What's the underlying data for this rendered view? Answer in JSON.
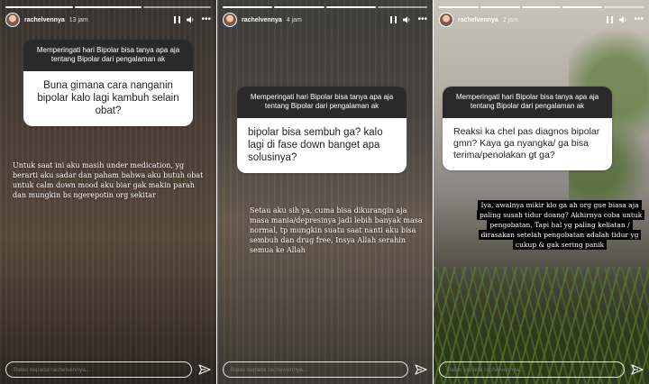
{
  "stories": [
    {
      "username": "rachelvennya",
      "time": "13 jam",
      "question_header": "Memperingati hari Bipolar bisa tanya apa aja tentang Bipolar dari pengalaman ak",
      "question": "Buna gimana cara nanganin bipolar kalo lagi kambuh selain obat?",
      "answer": "Untuk saat ini aku masih under medication, yg berarti aku sadar dan paham bahwa aku butuh obat untuk calm down mood aku biar gak makin parah dan mungkin bs ngerepotin org sekitar",
      "reply_placeholder": "Balas kepada rachelvennya..."
    },
    {
      "username": "rachelvennya",
      "time": "4 jam",
      "question_header": "Memperingati hari Bipolar bisa tanya apa aja tentang Bipolar dari pengalaman ak",
      "question": "bipolar bisa sembuh ga? kalo lagi di fase down banget apa solusinya?",
      "answer": "Setau aku sih ya, cuma bisa dikurangin aja masa mania/depresinya jadi lebih banyak masa normal, tp mungkin suatu saat nanti aku bisa sembuh dan drug free, Insya Allah serahin semua ke Allah",
      "reply_placeholder": "Balas kepada rachelvennya..."
    },
    {
      "username": "rachelvennya",
      "time": "2 jam",
      "question_header": "Memperingati hari Bipolar bisa tanya apa aja tentang Bipolar dari pengalaman ak",
      "question": "Reaksi ka chel pas diagnos bipolar gmn? Kaya ga nyangka/ ga bisa terima/penolakan gt ga?",
      "answer": "Iya, awalnya mikir klo ga ah org gue biasa aja paling susah tidur doang? Akhirnya coba untuk pengobatan, Tapi hal yg paling keliatan / dirasakan setelah pengobatan adalah tidur yg cukup & gak sering panik",
      "reply_placeholder": "Balas kepada rachelvennya..."
    }
  ],
  "icons": {
    "pause": "pause-icon",
    "sound": "speaker-icon",
    "more": "more-icon",
    "send": "send-icon"
  }
}
